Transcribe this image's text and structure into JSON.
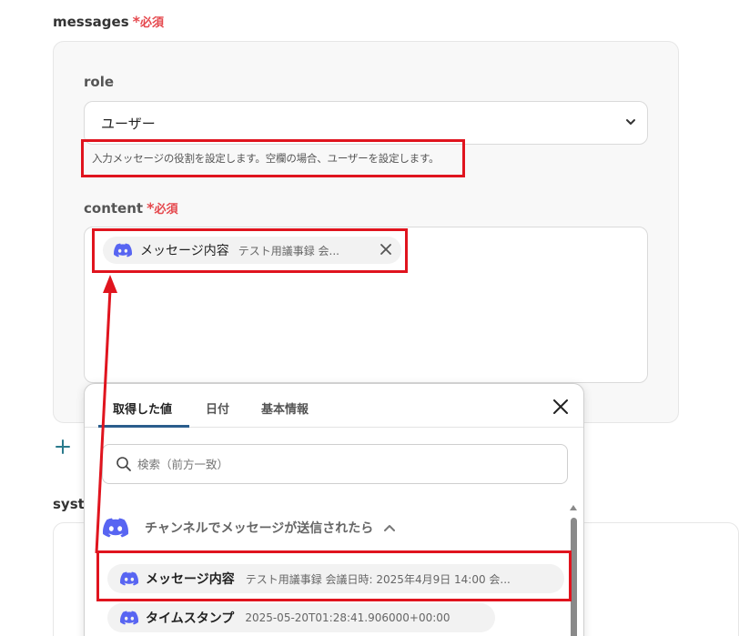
{
  "messages": {
    "label": "messages",
    "required_mark": "*",
    "required_text": "必須",
    "role": {
      "label": "role",
      "selected": "ユーザー",
      "hint": "入力メッセージの役割を設定します。空欄の場合、ユーザーを設定します。"
    },
    "content": {
      "label": "content",
      "required_mark": "*",
      "required_text": "必須",
      "chip": {
        "name": "メッセージ内容",
        "preview": "テスト用議事録 会..."
      }
    }
  },
  "system": {
    "label": "syst"
  },
  "popup": {
    "tabs": [
      {
        "label": "取得した値",
        "active": true
      },
      {
        "label": "日付",
        "active": false
      },
      {
        "label": "基本情報",
        "active": false
      }
    ],
    "search_placeholder": "検索（前方一致）",
    "group": {
      "label": "チャンネルでメッセージが送信されたら"
    },
    "items": [
      {
        "name": "メッセージ内容",
        "preview": "テスト用議事録 会議日時: 2025年4月9日 14:00 会..."
      },
      {
        "name": "タイムスタンプ",
        "preview": "2025-05-20T01:28:41.906000+00:00"
      }
    ]
  },
  "colors": {
    "highlight": "#e0141e",
    "required": "#e5484d",
    "tab_underline": "#2a5d8c",
    "discord": "#5865f2",
    "add_plus": "#2a7a8c"
  }
}
